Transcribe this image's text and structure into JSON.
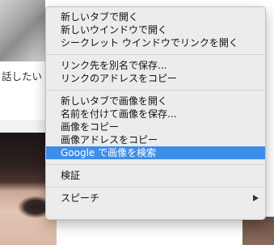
{
  "background": {
    "text_fragment": "話したい"
  },
  "context_menu": {
    "groups": [
      {
        "items": [
          {
            "label": "新しいタブで開く"
          },
          {
            "label": "新しいウインドウで開く"
          },
          {
            "label": "シークレット ウインドウでリンクを開く"
          }
        ]
      },
      {
        "items": [
          {
            "label": "リンク先を別名で保存..."
          },
          {
            "label": "リンクのアドレスをコピー"
          }
        ]
      },
      {
        "items": [
          {
            "label": "新しいタブで画像を開く"
          },
          {
            "label": "名前を付けて画像を保存..."
          },
          {
            "label": "画像をコピー"
          },
          {
            "label": "画像アドレスをコピー"
          },
          {
            "label": "Google で画像を検索",
            "highlighted": true
          }
        ]
      },
      {
        "items": [
          {
            "label": "検証"
          }
        ]
      },
      {
        "items": [
          {
            "label": "スピーチ",
            "has_submenu": true
          }
        ]
      }
    ],
    "highlight_color": "#3d8ee8"
  }
}
